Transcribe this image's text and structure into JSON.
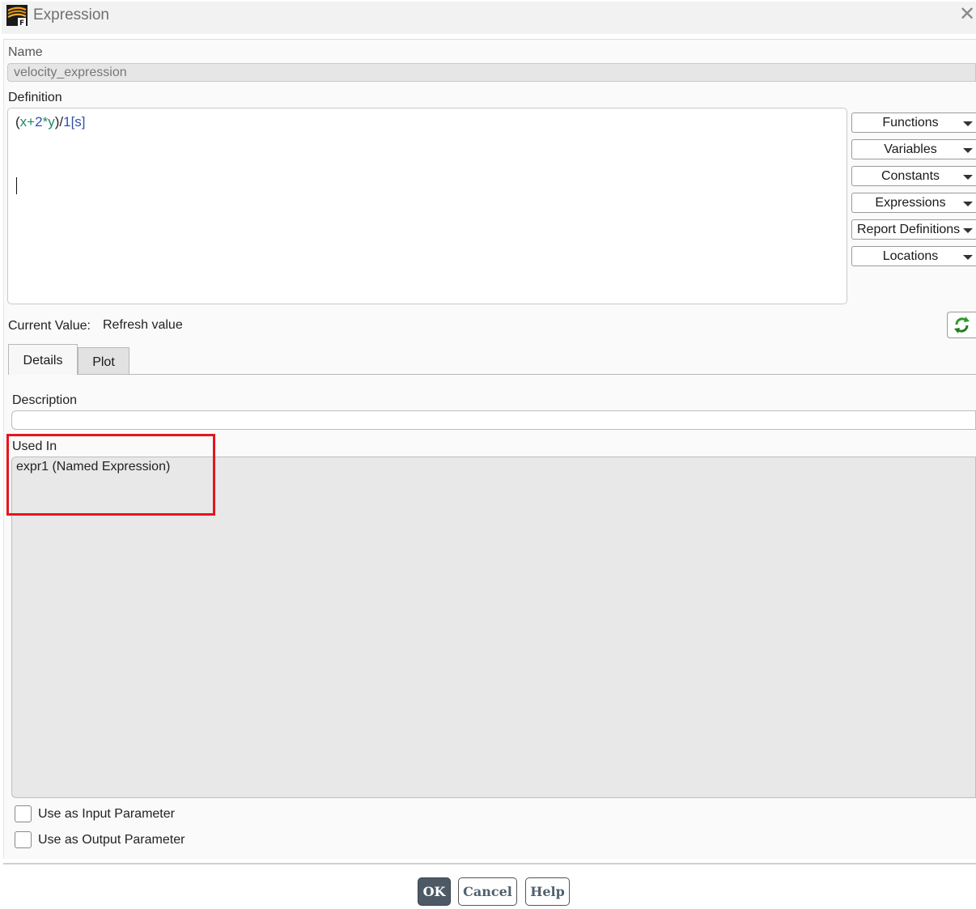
{
  "window": {
    "title": "Expression",
    "close_icon": "close-icon",
    "app_icon": "fluent-logo-icon"
  },
  "name": {
    "label": "Name",
    "value": "velocity_expression"
  },
  "definition": {
    "label": "Definition",
    "tokens": [
      {
        "text": "(",
        "color": "#222222"
      },
      {
        "text": "x",
        "color": "#1d8a5c"
      },
      {
        "text": "+",
        "color": "#1d8a5c"
      },
      {
        "text": "2",
        "color": "#2f4fb0"
      },
      {
        "text": "*",
        "color": "#1d8a5c"
      },
      {
        "text": "y",
        "color": "#1d8a5c"
      },
      {
        "text": ")/",
        "color": "#222222"
      },
      {
        "text": "1",
        "color": "#2f4fb0"
      },
      {
        "text": "[s]",
        "color": "#2f4fb0"
      }
    ]
  },
  "insert_menus": [
    "Functions",
    "Variables",
    "Constants",
    "Expressions",
    "Report Definitions",
    "Locations"
  ],
  "current_value": {
    "label": "Current Value:",
    "value": "Refresh value",
    "refresh_icon": "refresh-icon"
  },
  "tabs": [
    {
      "label": "Details",
      "active": true
    },
    {
      "label": "Plot",
      "active": false
    }
  ],
  "details": {
    "description_label": "Description",
    "description_value": "",
    "used_in_label": "Used In",
    "used_in_items": [
      "expr1 (Named Expression)"
    ],
    "highlight_color": "#e8141c"
  },
  "parameters": [
    {
      "label": "Use as Input Parameter",
      "checked": false
    },
    {
      "label": "Use as Output Parameter",
      "checked": false
    }
  ],
  "footer": {
    "ok": "OK",
    "cancel": "Cancel",
    "help": "Help"
  }
}
